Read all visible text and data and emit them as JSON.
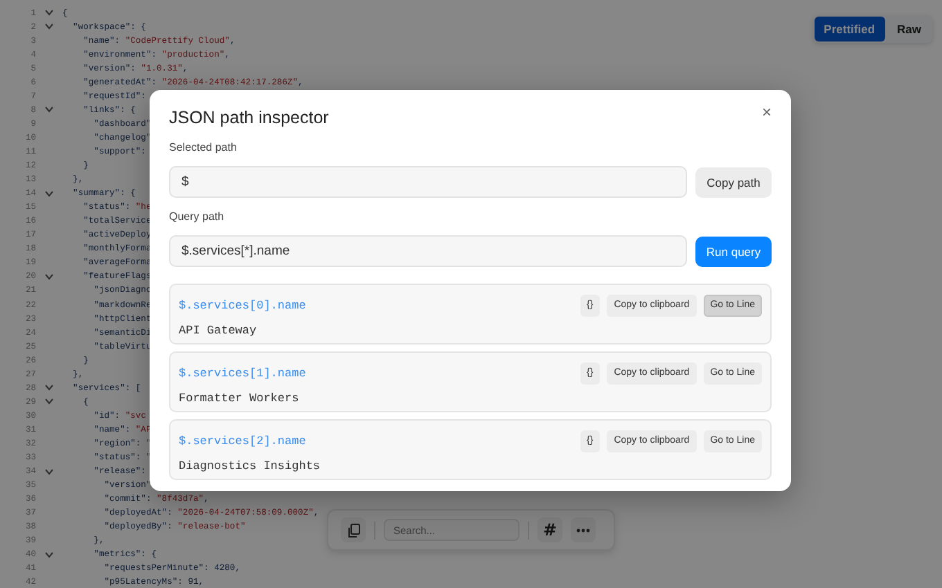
{
  "editor": {
    "lines": [
      {
        "n": "1",
        "fold": true,
        "code": "{"
      },
      {
        "n": "2",
        "fold": true,
        "code": "  \"workspace\": {"
      },
      {
        "n": "3",
        "fold": false,
        "code": "    \"name\": ",
        "value": "\"CodePrettify Cloud\"",
        "tail": ","
      },
      {
        "n": "4",
        "fold": false,
        "code": "    \"environment\": ",
        "value": "\"production\"",
        "tail": ","
      },
      {
        "n": "5",
        "fold": false,
        "code": "    \"version\": ",
        "value": "\"1.0.31\"",
        "tail": ","
      },
      {
        "n": "6",
        "fold": false,
        "code": "    \"generatedAt\": ",
        "value": "\"2026-04-24T08:42:17.286Z\"",
        "tail": ","
      },
      {
        "n": "7",
        "fold": false,
        "code": "    \"requestId\":"
      },
      {
        "n": "8",
        "fold": true,
        "code": "    \"links\": {"
      },
      {
        "n": "9",
        "fold": false,
        "code": "      \"dashboard\""
      },
      {
        "n": "10",
        "fold": false,
        "code": "      \"changelog\""
      },
      {
        "n": "11",
        "fold": false,
        "code": "      \"support\":"
      },
      {
        "n": "12",
        "fold": false,
        "code": "    }"
      },
      {
        "n": "13",
        "fold": false,
        "code": "  },"
      },
      {
        "n": "14",
        "fold": true,
        "code": "  \"summary\": {"
      },
      {
        "n": "15",
        "fold": false,
        "code": "    \"status\": ",
        "value": "\"he"
      },
      {
        "n": "16",
        "fold": false,
        "code": "    \"totalService"
      },
      {
        "n": "17",
        "fold": false,
        "code": "    \"activeDeploy"
      },
      {
        "n": "18",
        "fold": false,
        "code": "    \"monthlyForma"
      },
      {
        "n": "19",
        "fold": false,
        "code": "    \"averageForma"
      },
      {
        "n": "20",
        "fold": true,
        "code": "    \"featureFlags"
      },
      {
        "n": "21",
        "fold": false,
        "code": "      \"jsonDiagno"
      },
      {
        "n": "22",
        "fold": false,
        "code": "      \"markdownRe"
      },
      {
        "n": "23",
        "fold": false,
        "code": "      \"httpClient"
      },
      {
        "n": "24",
        "fold": false,
        "code": "      \"semanticDi"
      },
      {
        "n": "25",
        "fold": false,
        "code": "      \"tableVirtu"
      },
      {
        "n": "26",
        "fold": false,
        "code": "    }"
      },
      {
        "n": "27",
        "fold": false,
        "code": "  },"
      },
      {
        "n": "28",
        "fold": true,
        "code": "  \"services\": ["
      },
      {
        "n": "29",
        "fold": true,
        "code": "    {"
      },
      {
        "n": "30",
        "fold": false,
        "code": "      \"id\": ",
        "value": "\"svc"
      },
      {
        "n": "31",
        "fold": false,
        "code": "      \"name\": ",
        "value": "\"AP"
      },
      {
        "n": "32",
        "fold": false,
        "code": "      \"region\": ",
        "value": "\""
      },
      {
        "n": "33",
        "fold": false,
        "code": "      \"status\": ",
        "value": "\""
      },
      {
        "n": "34",
        "fold": true,
        "code": "      \"release\":"
      },
      {
        "n": "35",
        "fold": false,
        "code": "        \"version\""
      },
      {
        "n": "36",
        "fold": false,
        "code": "        \"commit\": ",
        "value": "\"8f43d7a\"",
        "tail": ","
      },
      {
        "n": "37",
        "fold": false,
        "code": "        \"deployedAt\": ",
        "value": "\"2026-04-24T07:58:09.000Z\"",
        "tail": ","
      },
      {
        "n": "38",
        "fold": false,
        "code": "        \"deployedBy\": ",
        "value": "\"release-bot\""
      },
      {
        "n": "39",
        "fold": false,
        "code": "      },"
      },
      {
        "n": "40",
        "fold": true,
        "code": "      \"metrics\": {"
      },
      {
        "n": "41",
        "fold": false,
        "code": "        \"requestsPerMinute\": 4280,"
      },
      {
        "n": "42",
        "fold": false,
        "code": "        \"p95LatencyMs\": 91,"
      }
    ]
  },
  "view_toggle": [
    {
      "label": "Prettified",
      "selected": true
    },
    {
      "label": "Raw",
      "selected": false
    }
  ],
  "toolbar": {
    "search": {
      "placeholder": "Search..."
    },
    "line_numbers_button": "#"
  },
  "dialog": {
    "title": "JSON path inspector",
    "close": "×",
    "selected_path": {
      "label": "Selected path",
      "value": "$",
      "button": "Copy path"
    },
    "query_path": {
      "label": "Query path",
      "value": "$.services[*].name",
      "button": "Run query"
    },
    "results": [
      {
        "path": "$.services[0].name",
        "value": "API Gateway",
        "actions": [
          "{}",
          "Copy to clipboard",
          "Go to Line"
        ],
        "highlighted": true
      },
      {
        "path": "$.services[1].name",
        "value": "Formatter Workers",
        "actions": [
          "{}",
          "Copy to clipboard",
          "Go to Line"
        ],
        "highlighted": false
      },
      {
        "path": "$.services[2].name",
        "value": "Diagnostics Insights",
        "actions": [
          "{}",
          "Copy to clipboard",
          "Go to Line"
        ],
        "highlighted": false
      }
    ]
  }
}
